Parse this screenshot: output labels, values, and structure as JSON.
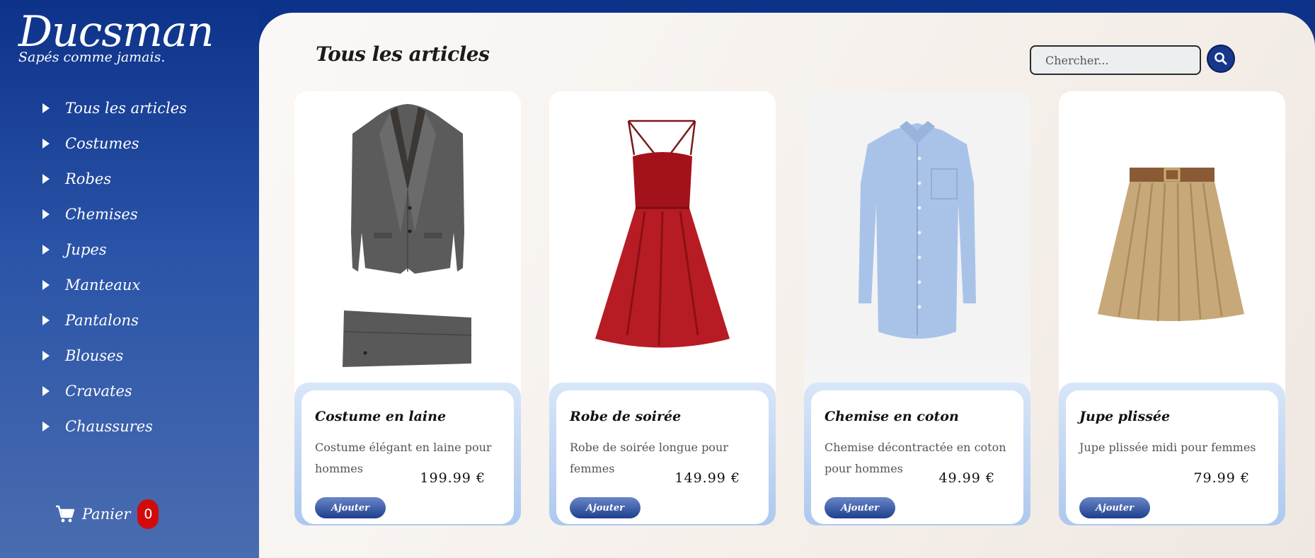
{
  "brand": {
    "name": "Ducsman",
    "tagline": "Sapés comme jamais."
  },
  "nav": {
    "items": [
      {
        "label": "Tous les articles"
      },
      {
        "label": "Costumes"
      },
      {
        "label": "Robes"
      },
      {
        "label": "Chemises"
      },
      {
        "label": "Jupes"
      },
      {
        "label": "Manteaux"
      },
      {
        "label": "Pantalons"
      },
      {
        "label": "Blouses"
      },
      {
        "label": "Cravates"
      },
      {
        "label": "Chaussures"
      }
    ]
  },
  "cart": {
    "label": "Panier",
    "count": "0"
  },
  "main": {
    "title": "Tous les articles"
  },
  "search": {
    "placeholder": "Chercher..."
  },
  "products": [
    {
      "name": "Costume en laine",
      "description": "Costume élégant en laine pour hommes",
      "price": "199.99 €",
      "button": "Ajouter",
      "image": "suit-image"
    },
    {
      "name": "Robe de soirée",
      "description": "Robe de soirée longue pour femmes",
      "price": "149.99 €",
      "button": "Ajouter",
      "image": "dress-image"
    },
    {
      "name": "Chemise en coton",
      "description": "Chemise décontractée en coton pour hommes",
      "price": "49.99 €",
      "button": "Ajouter",
      "image": "shirt-image"
    },
    {
      "name": "Jupe plissée",
      "description": "Jupe plissée midi pour femmes",
      "price": "79.99 €",
      "button": "Ajouter",
      "image": "skirt-image"
    }
  ],
  "colors": {
    "sidebar": "#0d3289",
    "accent": "#16378c",
    "badge": "#d10b0b"
  }
}
